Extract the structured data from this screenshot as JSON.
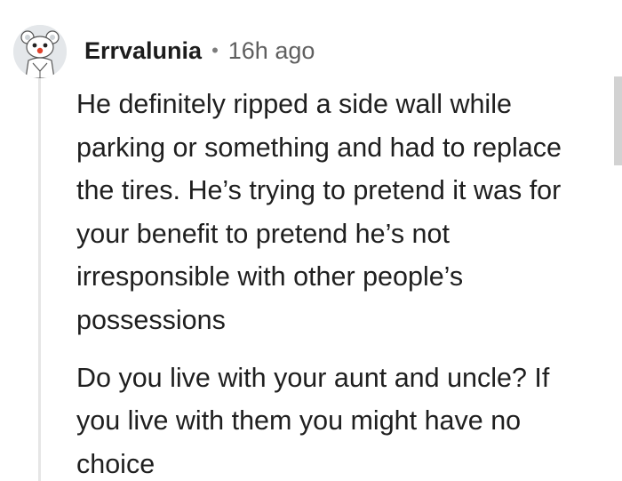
{
  "comment": {
    "username": "Errvalunia",
    "separator": "•",
    "timestamp": "16h ago",
    "avatar_icon": "snoo-avatar-icon",
    "paragraph1_lines": [
      "He definitely ripped a side wall while",
      "parking or something and had to replace",
      "the tires. He’s trying to pretend it was for",
      "your benefit to pretend he’s not",
      "irresponsible with other people’s",
      "possessions"
    ],
    "paragraph2_lines": [
      "Do you live with your aunt and uncle? If",
      "you live with them you might have no",
      "choice"
    ]
  },
  "colors": {
    "text": "#1c1c1c",
    "meta": "#5f5f5f",
    "thread_line": "#e6e6e6",
    "background": "#ffffff"
  }
}
